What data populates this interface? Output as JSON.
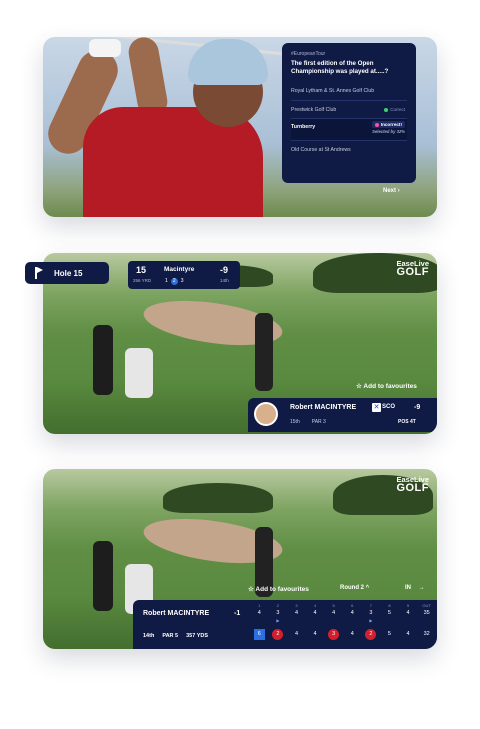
{
  "colors": {
    "navy": "#0f1a45",
    "accent_red": "#d3202f",
    "accent_blue": "#2b6fe0",
    "correct_green": "#3bd16f",
    "incorrect_pink": "#ff4fa3"
  },
  "card1": {
    "tag": "#EuropeanTour",
    "question": "The first edition of the Open Championship was played at.....?",
    "options": [
      {
        "label": "Royal Lytham & St. Annes Golf Club",
        "note": ""
      },
      {
        "label": "Prestwick Golf Club",
        "note": "Correct"
      },
      {
        "label": "Turnberry",
        "note": "Incorrect!",
        "selected_by": "Selected by 32%"
      },
      {
        "label": "Old Course at St Andrews",
        "note": ""
      }
    ],
    "next_label": "Next",
    "next_icon": "chevron-right-icon"
  },
  "card2": {
    "hole_label": "Hole 15",
    "scorebox": {
      "hole": "15",
      "yards": "256 YRD",
      "player": "Macintyre",
      "shots": [
        "1",
        "2",
        "3"
      ],
      "current_shot": "2",
      "score": "-9",
      "position": "14th"
    },
    "logo_top": "EaseLive",
    "logo_bottom": "GOLF",
    "favourite": "Add to favourites",
    "player": {
      "name": "Robert MACINTYRE",
      "country": "SCO",
      "score": "-9",
      "rank": "15th",
      "par": "PAR 3",
      "pos": "POS 4T"
    }
  },
  "card3": {
    "logo_top": "EaseLive",
    "logo_bottom": "GOLF",
    "favourite": "Add to favourites",
    "round": "Round 2",
    "in_label": "IN",
    "player": {
      "name": "Robert MACINTYRE",
      "score": "-1",
      "rank": "14th",
      "par": "PAR 5",
      "yds": "357 YDS"
    },
    "holes": [
      {
        "n": "1",
        "par": "4",
        "result": "6",
        "style": "square"
      },
      {
        "n": "2",
        "par": "3",
        "result": "2",
        "style": "circle",
        "play": "▶"
      },
      {
        "n": "3",
        "par": "4",
        "result": "4",
        "style": ""
      },
      {
        "n": "4",
        "par": "4",
        "result": "4",
        "style": ""
      },
      {
        "n": "5",
        "par": "4",
        "result": "3",
        "style": "circle"
      },
      {
        "n": "6",
        "par": "4",
        "result": "4",
        "style": ""
      },
      {
        "n": "7",
        "par": "3",
        "result": "2",
        "style": "circle",
        "play": "▶"
      },
      {
        "n": "8",
        "par": "5",
        "result": "5",
        "style": ""
      },
      {
        "n": "9",
        "par": "4",
        "result": "4",
        "style": ""
      },
      {
        "n": "OUT",
        "par": "35",
        "result": "32",
        "style": ""
      }
    ]
  }
}
